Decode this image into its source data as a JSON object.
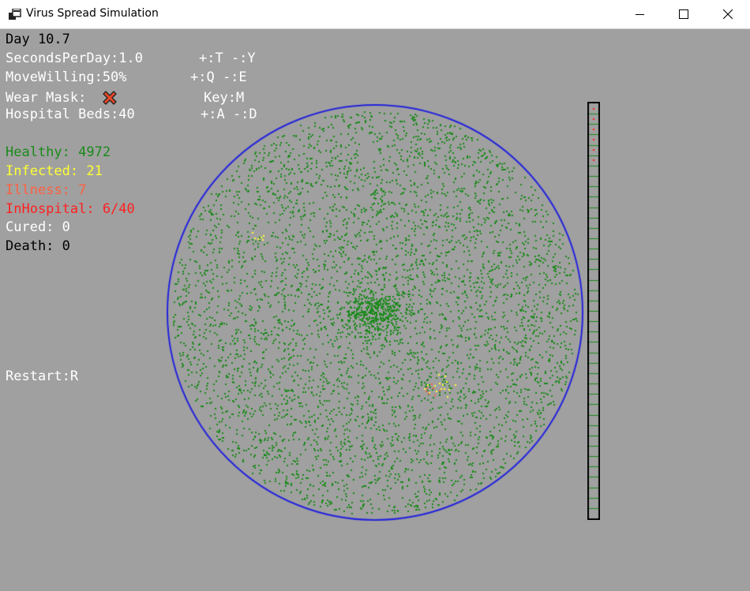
{
  "window": {
    "title": "Virus Spread Simulation",
    "buttons": [
      "minimize",
      "maximize",
      "close"
    ]
  },
  "settings": {
    "day": "Day 10.7",
    "seconds_per_day": "SecondsPerDay:1.0",
    "seconds_per_day_keys": "+:T -:Y",
    "move_willing": "MoveWilling:50%",
    "move_willing_keys": "+:Q -:E",
    "wear_mask_label": "Wear Mask:",
    "wear_mask_enabled": false,
    "wear_mask_icon": "cross-icon",
    "wear_mask_key": "Key:M",
    "hospital_beds": "Hospital Beds:40",
    "hospital_beds_keys": "+:A -:D"
  },
  "stats": {
    "healthy": "Healthy: 4972",
    "infected": "Infected: 21",
    "illness": "Illness: 7",
    "in_hospital": "InHospital: 6/40",
    "cured": "Cured: 0",
    "death": "Death: 0"
  },
  "restart_label": "Restart:R",
  "colors": {
    "background": "#a0a0a0",
    "healthy": "#1a8a1a",
    "infected": "#ffff33",
    "illness": "#ff6040",
    "in_hospital": "#ff2020",
    "cured": "#ffffff",
    "death": "#000000",
    "boundary": "#2222dd"
  },
  "hospital": {
    "capacity": 40,
    "occupied": 6
  },
  "population": {
    "healthy": 4972,
    "infected": 21,
    "illness": 7
  }
}
